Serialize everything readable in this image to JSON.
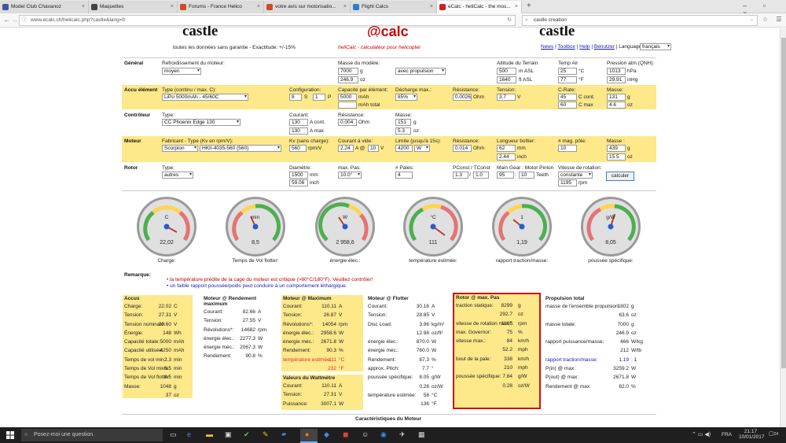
{
  "browser": {
    "tabs": [
      {
        "label": "Model Club Chavanoz",
        "color": "#3b5998"
      },
      {
        "label": "Maquettes",
        "color": "#444"
      },
      {
        "label": "Forums - France Helico",
        "color": "#d04a2a"
      },
      {
        "label": "votre avis sur motorisatio...",
        "color": "#d04a2a"
      },
      {
        "label": "Flight Calcs",
        "color": "#2a7fd0"
      },
      {
        "label": "eCalc - heliCalc - the mos...",
        "color": "#d02020"
      }
    ],
    "url": "www.ecalc.ch/helicalc.php?castle&lang=fr",
    "search": "castle creation"
  },
  "header": {
    "logo_left": "castle",
    "logo_mid": "calc",
    "logo_right": "castle",
    "disclaimer": "toutes les données sans garantie - Exactitude: +/-15%",
    "tagline": "heliCalc - calculateur pour helicopter",
    "links": [
      "News",
      "Toolbox",
      "Help",
      "Benutzer"
    ],
    "lang_label": "Language:",
    "lang_value": "français"
  },
  "general": {
    "title": "Général",
    "cooling_label": "Refroidissement du moteur:",
    "cooling_value": "moyen",
    "mass_label": "Masse du modèle:",
    "mass_g": "7000",
    "mass_g_unit": "g",
    "mass_oz": "246.9",
    "mass_oz_unit": "oz",
    "prop_value": "avec propulsion",
    "alt_label": "Altitude du Terrain",
    "alt_m": "500",
    "alt_m_unit": "m ASL",
    "alt_ft": "1640",
    "alt_ft_unit": "ft ASL",
    "temp_label": "Temp Air",
    "temp_c": "25",
    "temp_c_unit": "°C",
    "temp_f": "77",
    "temp_f_unit": "°F",
    "press_label": "Pression atm.(QNH):",
    "press_hpa": "1013",
    "press_hpa_unit": "hPa",
    "press_inhg": "29.91",
    "press_inhg_unit": "inHg"
  },
  "battery": {
    "title": "Accu élément",
    "type_label": "Type (continu / max. C):",
    "type_value": "LiPo 5000mAh - 45/60C",
    "config_label": "Configuration:",
    "config_s": "8",
    "config_s_unit": "S",
    "config_p": "1",
    "config_p_unit": "P",
    "cap_label": "Capacité par élément:",
    "cap_mah": "5000",
    "cap_mah_unit": "mAh",
    "cap_total_unit": "mAh total",
    "discharge_label": "Décharge max.:",
    "discharge_value": "85%",
    "res_label": "Résistance:",
    "res_value": "0.0026",
    "res_unit": "Ohm",
    "volt_label": "Tension:",
    "volt_value": "3.7",
    "volt_unit": "V",
    "crate_label": "C-Rate:",
    "crate_cont": "45",
    "crate_cont_unit": "C cont.",
    "crate_max": "60",
    "crate_max_unit": "C max",
    "mass_label": "Masse:",
    "mass_g": "131",
    "mass_g_unit": "g",
    "mass_oz": "4.6",
    "mass_oz_unit": "oz"
  },
  "controller": {
    "title": "Contrôleur",
    "type_label": "Type:",
    "type_value": "CC Phoenix Edge 130",
    "current_label": "Courant:",
    "current_cont": "130",
    "current_cont_unit": "A cont.",
    "current_max": "130",
    "current_max_unit": "A max",
    "res_label": "Résistance:",
    "res_value": "0.004",
    "res_unit": "Ohm",
    "mass_label": "Masse:",
    "mass_g": "151",
    "mass_g_unit": "g",
    "mass_oz": "5.3",
    "mass_oz_unit": "oz"
  },
  "motor": {
    "title": "Moteur",
    "maker_label": "Fabricant - Type (Kv en rpm/V):",
    "maker_value": "Scorpion",
    "type_value": "HKII-4035-560 (560)",
    "kv_label": "Kv (sans charge):",
    "kv_value": "560",
    "kv_unit": "rpm/V",
    "noload_label": "Courant à vide:",
    "noload_a": "2.24",
    "noload_a_unit": "A @",
    "noload_v": "10",
    "noload_v_unit": "V",
    "limit_label": "Limite (jusqu'à 15s):",
    "limit_value": "4200",
    "limit_unit": "W",
    "res_label": "Résistance:",
    "res_value": "0.014",
    "res_unit": "Ohm",
    "len_label": "Longueur boîtier:",
    "len_mm": "62",
    "len_mm_unit": "mm",
    "len_in": "2.44",
    "len_in_unit": "inch",
    "poles_label": "# mag. pôle:",
    "poles_value": "10",
    "mass_label": "Masse :",
    "mass_g": "439",
    "mass_g_unit": "g",
    "mass_oz": "15.5",
    "mass_oz_unit": "oz"
  },
  "rotor": {
    "title": "Rotor",
    "type_label": "Type:",
    "type_value": "autres",
    "diam_label": "Diamètre:",
    "diam_mm": "1500",
    "diam_mm_unit": "mm",
    "diam_in": "59.06",
    "diam_in_unit": "inch",
    "pitch_label": "max. Pas:",
    "pitch_value": "10.0°",
    "blades_label": "# Pales:",
    "blades_value": "4",
    "pconst_label": "PConst / TConst",
    "pconst": "1.3",
    "tconst": "1.0",
    "gear_label": "Main Gear : Motor Pinion",
    "gear_main": "95",
    "gear_pinion": "10",
    "gear_unit": "Teeth",
    "speed_label": "Vitesse de rotation:",
    "speed_mode": "constante",
    "speed_value": "1195",
    "speed_unit": "rpm",
    "calc_button": "calculer"
  },
  "gauges": [
    {
      "unit": "C",
      "value": "22,02",
      "caption": "Charge:"
    },
    {
      "unit": "min",
      "value": "8,5",
      "caption": "Temps de Vol flotter:"
    },
    {
      "unit": "W",
      "value": "2 958,6",
      "caption": "énergie élec.:"
    },
    {
      "unit": "°C",
      "value": "111",
      "caption": "température estimée:"
    },
    {
      "unit": "1",
      "value": "1,19",
      "caption": "rapport traction/masse:"
    },
    {
      "unit": "g/W",
      "value": "8,05",
      "caption": "poussée spécifique:"
    }
  ],
  "remarks": {
    "title": "Remarque:",
    "items": [
      {
        "text": "la température prédite de la cage du moteur est critique (>80°C/180°F). Veuillez contrôler!",
        "color": "#c00000"
      },
      {
        "text": "un faible rapport poussée/poids peut conduire à un comportement léthargique.",
        "color": "#1a1ab0"
      }
    ]
  },
  "results": {
    "accu": {
      "title": "Accus",
      "rows": [
        {
          "k": "Charge:",
          "v": "22.02",
          "u": "C"
        },
        {
          "k": "Tension:",
          "v": "27.31",
          "u": "V"
        },
        {
          "k": "Tension nominale:",
          "v": "29.60",
          "u": "V"
        },
        {
          "k": "Énergie:",
          "v": "148",
          "u": "Wh"
        },
        {
          "k": "Capacité totale:",
          "v": "5000",
          "u": "mAh"
        },
        {
          "k": "Capacité utilisée:",
          "v": "4250",
          "u": "mAh"
        },
        {
          "k": "Temps de vol min.:",
          "v": "2.3",
          "u": "min"
        },
        {
          "k": "Temps de Vol mixte:",
          "v": "6.5",
          "u": "min"
        },
        {
          "k": "Temps de Vol flotter:",
          "v": "8.5",
          "u": "min"
        },
        {
          "k": "Masse:",
          "v": "1048",
          "u": "g"
        },
        {
          "k": "",
          "v": "37",
          "u": "oz"
        }
      ]
    },
    "max_eff": {
      "title": "Moteur @ Rendement maximum",
      "rows": [
        {
          "k": "Courant:",
          "v": "82.66",
          "u": "A"
        },
        {
          "k": "Tension:",
          "v": "27.55",
          "u": "V"
        },
        {
          "k": "Révolutions*:",
          "v": "14682",
          "u": "rpm"
        },
        {
          "k": "énergie élec.:",
          "v": "2277.3",
          "u": "W"
        },
        {
          "k": "énergie méc.:",
          "v": "2067.3",
          "u": "W"
        },
        {
          "k": "Rendement:",
          "v": "90.8",
          "u": "%"
        }
      ]
    },
    "max": {
      "title": "Moteur @ Maximum",
      "rows": [
        {
          "k": "Courant:",
          "v": "110.11",
          "u": "A"
        },
        {
          "k": "Tension:",
          "v": "26.87",
          "u": "V"
        },
        {
          "k": "Révolutions*:",
          "v": "14054",
          "u": "rpm"
        },
        {
          "k": "énergie élec.:",
          "v": "2958.6",
          "u": "W"
        },
        {
          "k": "énergie méc.:",
          "v": "2671.8",
          "u": "W"
        },
        {
          "k": "Rendement:",
          "v": "90.3",
          "u": "%"
        },
        {
          "k": "température estimée:",
          "v": "111",
          "u": "°C",
          "warn": true
        },
        {
          "k": "",
          "v": "232",
          "u": "°F",
          "warn": true
        }
      ]
    },
    "wattmeter": {
      "title": "Valeurs du Wattmètre",
      "rows": [
        {
          "k": "Courant:",
          "v": "110.11",
          "u": "A"
        },
        {
          "k": "Tension:",
          "v": "27.31",
          "u": "V"
        },
        {
          "k": "Puissance:",
          "v": "3007.1",
          "u": "W"
        }
      ]
    },
    "hover": {
      "title": "Moteur @ Flotter",
      "rows": [
        {
          "k": "Courant:",
          "v": "30.16",
          "u": "A"
        },
        {
          "k": "Tension:",
          "v": "28.85",
          "u": "V"
        },
        {
          "k": "Disc Load:",
          "v": "3.96",
          "u": "kg/m²"
        },
        {
          "k": "",
          "v": "12.98",
          "u": "oz/ft²"
        },
        {
          "k": "énergie élec.:",
          "v": "870.0",
          "u": "W"
        },
        {
          "k": "énergie méc.:",
          "v": "760.0",
          "u": "W"
        },
        {
          "k": "Rendement:",
          "v": "87.3",
          "u": "%"
        },
        {
          "k": "approx. Pitch:",
          "v": "7.7",
          "u": "°"
        },
        {
          "k": "poussée spécifique:",
          "v": "8.05",
          "u": "g/W"
        },
        {
          "k": "",
          "v": "0.28",
          "u": "oz/W"
        },
        {
          "k": "température estimée:",
          "v": "58",
          "u": "°C"
        },
        {
          "k": "",
          "v": "136",
          "u": "°F"
        }
      ]
    },
    "rotor_max": {
      "title": "Rotor @ max. Pas",
      "rows": [
        {
          "k": "traction statique:",
          "v": "8299",
          "u": "g"
        },
        {
          "k": "",
          "v": "292.7",
          "u": "oz"
        },
        {
          "k": "vitesse de rotation max.*:",
          "v": "1195",
          "u": "rpm"
        },
        {
          "k": "max. Governor:",
          "v": "75",
          "u": "%"
        },
        {
          "k": "vitesse max.:",
          "v": "84",
          "u": "km/h"
        },
        {
          "k": "",
          "v": "52.2",
          "u": "mph"
        },
        {
          "k": "bout de la pale:",
          "v": "338",
          "u": "km/h"
        },
        {
          "k": "",
          "v": "210",
          "u": "mph"
        },
        {
          "k": "poussée spécifique:",
          "v": "7.84",
          "u": "g/W"
        },
        {
          "k": "",
          "v": "0.28",
          "u": "oz/W"
        }
      ]
    },
    "propulsion": {
      "title": "Propulsion total",
      "rows": [
        {
          "k": "masse de l'ensemble propulsion:",
          "v": "1802",
          "u": "g"
        },
        {
          "k": "",
          "v": "63.6",
          "u": "oz"
        },
        {
          "k": "masse totale:",
          "v": "7000",
          "u": "g"
        },
        {
          "k": "",
          "v": "246.9",
          "u": "oz"
        },
        {
          "k": "rapport puissance/masse:",
          "v": "466",
          "u": "W/kg"
        },
        {
          "k": "",
          "v": "212",
          "u": "W/lb"
        },
        {
          "k": "rapport traction/masse:",
          "v": "1.19",
          "u": ": 1",
          "link": true
        },
        {
          "k": "P(in) @ max:",
          "v": "3259.2",
          "u": "W"
        },
        {
          "k": "P(out) @ max:",
          "v": "2671.8",
          "u": "W"
        },
        {
          "k": "Rendement @ max:",
          "v": "82.0",
          "u": "%"
        }
      ]
    }
  },
  "footer_title": "Caractéristiques du Moteur",
  "taskbar": {
    "search": "Posez-moi une question.",
    "lang": "FRA",
    "time": "21:17",
    "date": "10/01/2017",
    "notif": "24"
  }
}
